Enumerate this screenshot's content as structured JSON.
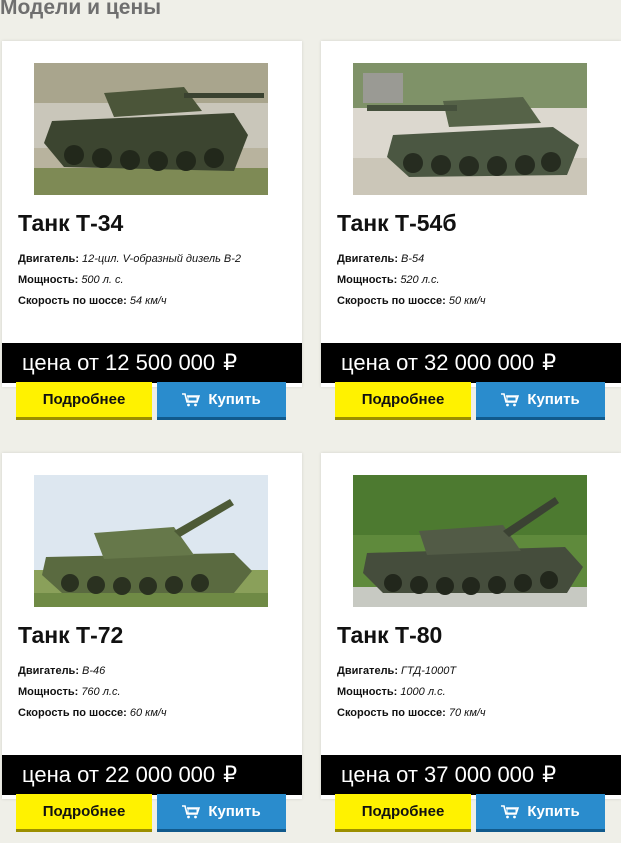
{
  "section_title": "Модели и цены",
  "labels": {
    "engine": "Двигатель:",
    "power": "Мощность:",
    "speed": "Скорость по шоссе:",
    "price_prefix": "цена от",
    "currency": "₽",
    "more_button": "Подробнее",
    "buy_button": "Купить"
  },
  "colors": {
    "more_button": "#fff200",
    "buy_button": "#2a8ccd",
    "price_bar": "#000000"
  },
  "products": [
    {
      "name": "Танк Т-34",
      "engine": "12-цил. V-образный дизель В-2",
      "power": "500 л. с.",
      "speed": "54 км/ч",
      "price": "12 500 000"
    },
    {
      "name": "Танк Т-54б",
      "engine": "В-54",
      "power": "520 л.с.",
      "speed": "50 км/ч",
      "price": "32 000 000"
    },
    {
      "name": "Танк Т-72",
      "engine": "В-46",
      "power": "760 л.с.",
      "speed": "60 км/ч",
      "price": "22 000 000"
    },
    {
      "name": "Танк Т-80",
      "engine": "ГТД-1000Т",
      "power": "1000 л.с.",
      "speed": "70 км/ч",
      "price": "37 000 000"
    }
  ]
}
